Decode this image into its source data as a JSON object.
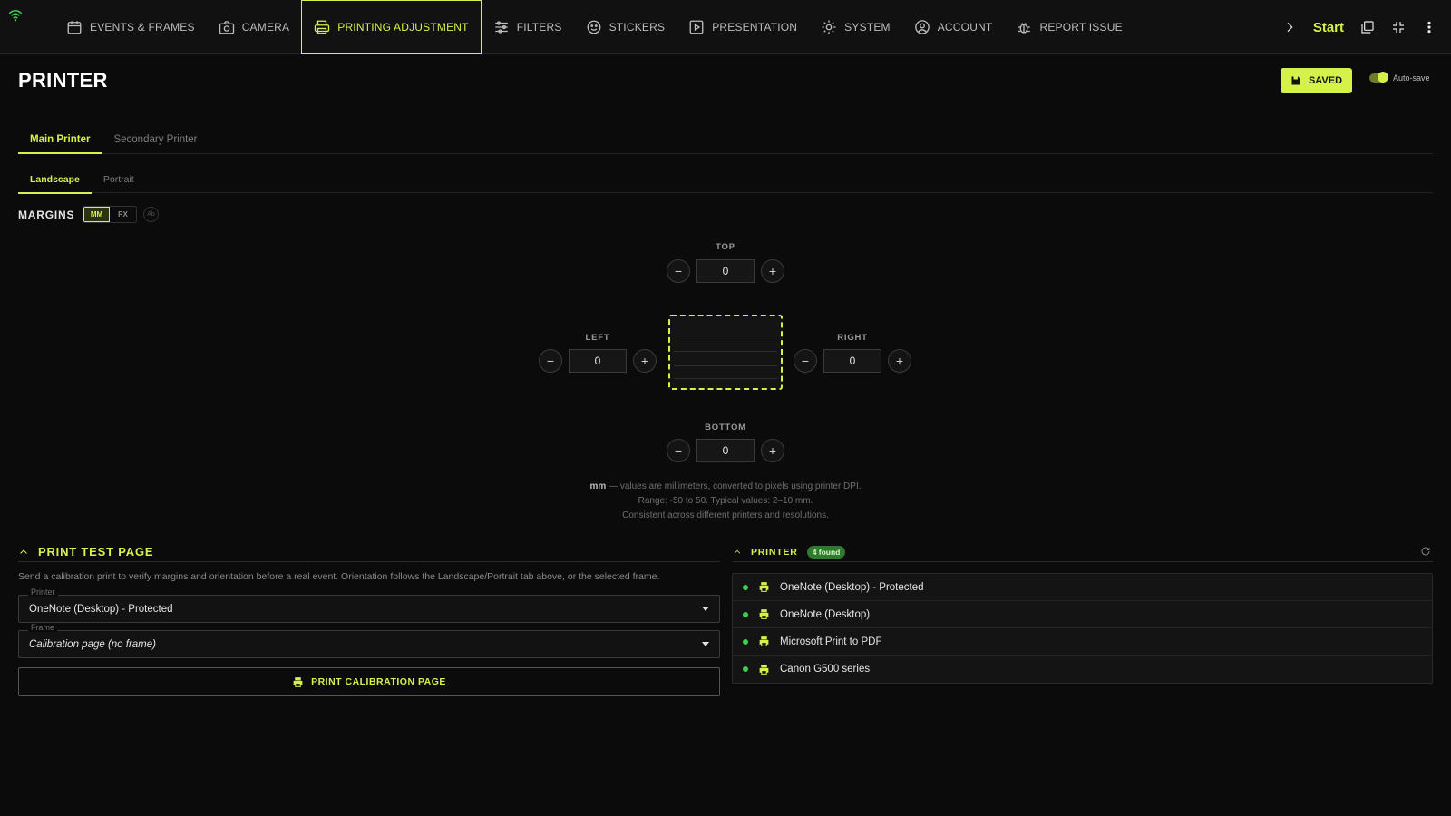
{
  "nav": {
    "items": [
      {
        "label": "EVENTS & FRAMES",
        "icon": "calendar-icon"
      },
      {
        "label": "CAMERA",
        "icon": "camera-icon"
      },
      {
        "label": "PRINTING ADJUSTMENT",
        "icon": "printer-icon",
        "active": true
      },
      {
        "label": "FILTERS",
        "icon": "sliders-icon"
      },
      {
        "label": "STICKERS",
        "icon": "smiley-icon"
      },
      {
        "label": "PRESENTATION",
        "icon": "play-icon"
      },
      {
        "label": "SYSTEM",
        "icon": "gear-icon"
      },
      {
        "label": "ACCOUNT",
        "icon": "user-icon"
      },
      {
        "label": "REPORT ISSUE",
        "icon": "bug-icon"
      }
    ],
    "start_label": "Start"
  },
  "header": {
    "title": "PRINTER",
    "saved_label": "SAVED",
    "autosave_label": "Auto-save",
    "autosave_on": true
  },
  "printer_tabs": [
    "Main Printer",
    "Secondary Printer"
  ],
  "orientation_tabs": [
    "Landscape",
    "Portrait"
  ],
  "margins": {
    "label": "MARGINS",
    "units": [
      "MM",
      "PX"
    ],
    "active_unit": "MM",
    "extra_label": "Ab",
    "top_label": "TOP",
    "top": "0",
    "left_label": "LEFT",
    "left": "0",
    "right_label": "RIGHT",
    "right": "0",
    "bottom_label": "BOTTOM",
    "bottom": "0",
    "minus": "−",
    "plus": "+",
    "hint_unit": "mm",
    "hint_line1": " — values are millimeters, converted to pixels using printer DPI.",
    "hint_line2": "Range: -50 to 50. Typical values: 2–10 mm.",
    "hint_line3": "Consistent across different printers and resolutions."
  },
  "test_page": {
    "title": "PRINT TEST PAGE",
    "description": "Send a calibration print to verify margins and orientation before a real event. Orientation follows the Landscape/Portrait tab above, or the selected frame.",
    "printer_label": "Printer",
    "printer_value": "OneNote (Desktop) - Protected",
    "frame_label": "Frame",
    "frame_value": "Calibration page (no frame)",
    "button_label": "PRINT CALIBRATION PAGE"
  },
  "printer_list": {
    "title": "PRINTER",
    "badge": "4 found",
    "items": [
      "OneNote (Desktop) - Protected",
      "OneNote (Desktop)",
      "Microsoft Print to PDF",
      "Canon G500 series"
    ],
    "status_color": "#3fcf52"
  },
  "colors": {
    "accent": "#d4f24a",
    "background": "#0b0b0b"
  }
}
